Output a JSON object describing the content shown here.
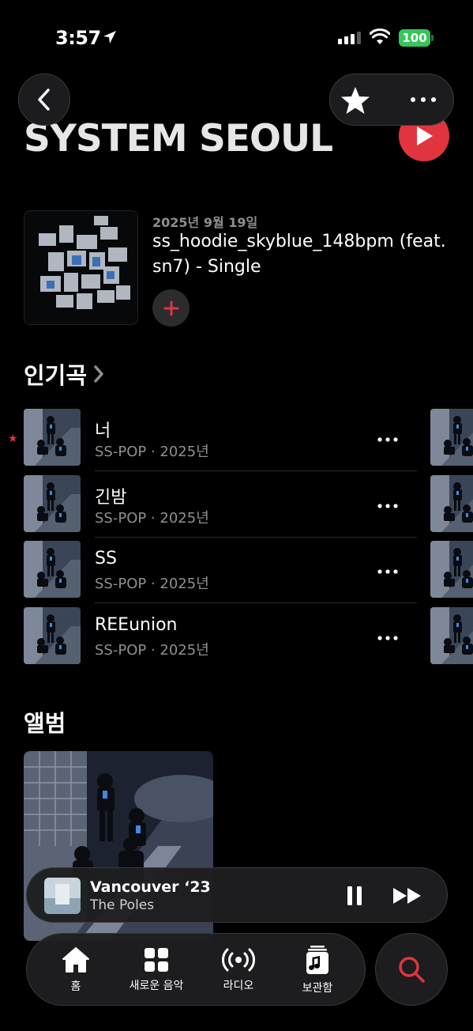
{
  "status_bar": {
    "time": "3:57",
    "battery": "100"
  },
  "header": {
    "artist_name": "SYSTEM SEOUL"
  },
  "latest_release": {
    "date": "2025년 9월 19일",
    "title": "ss_hoodie_skyblue_148bpm (feat. sn7) - Single"
  },
  "popular": {
    "heading": "인기곡",
    "songs": [
      {
        "title": "너",
        "meta": "SS-POP · 2025년",
        "favorited": true
      },
      {
        "title": "긴밤",
        "meta": "SS-POP · 2025년",
        "favorited": false
      },
      {
        "title": "SS",
        "meta": "SS-POP · 2025년",
        "favorited": false
      },
      {
        "title": "REEunion",
        "meta": "SS-POP · 2025년",
        "favorited": false
      }
    ]
  },
  "albums": {
    "heading": "앨범"
  },
  "now_playing": {
    "title": "Vancouver ‘23",
    "artist": "The Poles"
  },
  "tabs": [
    {
      "label": "홈",
      "icon": "home-icon"
    },
    {
      "label": "새로운 음악",
      "icon": "grid-icon"
    },
    {
      "label": "라디오",
      "icon": "radio-icon"
    },
    {
      "label": "보관함",
      "icon": "library-icon"
    }
  ],
  "colors": {
    "accent": "#e0353f",
    "battery": "#35c759",
    "secondary_text": "#8e8e93"
  }
}
